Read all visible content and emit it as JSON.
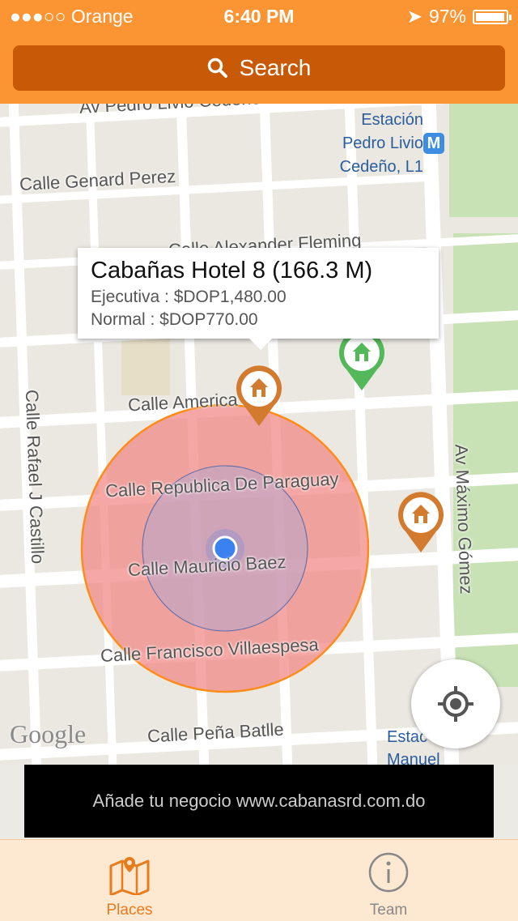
{
  "status_bar": {
    "carrier": "●●●○○ Orange",
    "time": "6:40 PM",
    "battery": "97%"
  },
  "search": {
    "label": "Search"
  },
  "map": {
    "streets": [
      "Av Pedro Livio Cedeño",
      "Calle Genard Perez",
      "Calle Alexander Fleming",
      "Calle America",
      "Calle Republica De Paraguay",
      "Calle Mauricio Baez",
      "Calle Francisco Villaespesa",
      "Calle Peña Batlle",
      "Calle Rafael J Castillo",
      "Av Máximo Gómez"
    ],
    "station_lines": [
      "Estación",
      "Pedro Livio",
      "Cedeño, L1"
    ],
    "station2": [
      "Estac",
      "Manuel"
    ],
    "metro_badge": "M",
    "watermark": "Google"
  },
  "callout": {
    "title": "Cabañas Hotel 8 (166.3 M)",
    "line1": "Ejecutiva : $DOP1,480.00",
    "line2": "Normal : $DOP770.00"
  },
  "banner": {
    "text": "Añade tu negocio www.cabanasrd.com.do"
  },
  "tabs": [
    {
      "label": "Places",
      "icon": "map-pin-icon",
      "active": true
    },
    {
      "label": "Team",
      "icon": "info-icon",
      "active": false
    }
  ],
  "colors": {
    "accent": "#fb9433",
    "accent_dark": "#c85a07",
    "pin_orange": "#d27a2e",
    "pin_green": "#52b85a",
    "radius_fill": "#f08a86"
  }
}
